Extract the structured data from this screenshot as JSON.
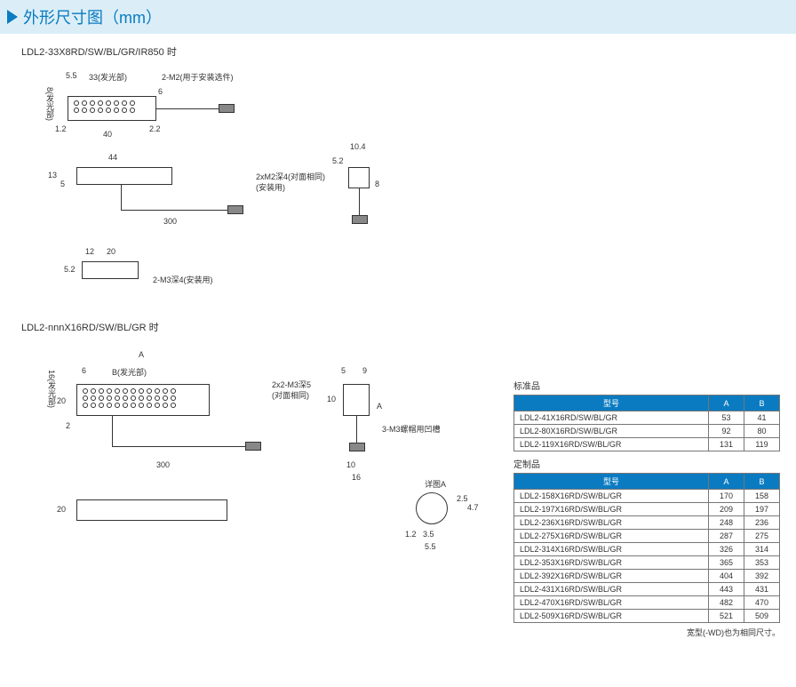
{
  "header": {
    "title": "外形尺寸图（mm）"
  },
  "section1": {
    "label": "LDL2-33X8RD/SW/BL/GR/IR850 时"
  },
  "drawing1": {
    "d5_5": "5.5",
    "d33": "33(发光部)",
    "d2m2": "2-M2(用于安装选件)",
    "d8": "8(发光部)",
    "d1_2": "1.2",
    "d6": "6",
    "d40": "40",
    "d2_2": "2.2",
    "d44": "44",
    "d13": "13",
    "d5a": "5",
    "d2xm2": "2xM2深4(对面相同)",
    "d_install": "(安装用)",
    "d300": "300",
    "d10_4": "10.4",
    "d5_2b": "5.2",
    "d8b": "8",
    "d12": "12",
    "d20": "20",
    "d5_2": "5.2",
    "d2m3": "2-M3深4(安装用)"
  },
  "section2": {
    "label": "LDL2-nnnX16RD/SW/BL/GR 时"
  },
  "drawing2": {
    "dA": "A",
    "d6": "6",
    "dB": "B(发光部)",
    "d16": "16(发光部)",
    "d20": "20",
    "d2": "2",
    "d2x2m3": "2x2-M3深5",
    "d_facing": "(对面相同)",
    "d5": "5",
    "d9": "9",
    "d10": "10",
    "dAside": "A",
    "d3m3": "3-M3螺帽用凹槽",
    "d300": "300",
    "d10b": "10",
    "d16b": "16",
    "d20b": "20",
    "detailA": "详图A",
    "d2_5": "2.5",
    "d4_7": "4.7",
    "d1_2": "1.2",
    "d3_5": "3.5",
    "d5_5": "5.5"
  },
  "tables": {
    "std_title": "标准品",
    "custom_title": "定制品",
    "col_model": "型号",
    "col_a": "A",
    "col_b": "B",
    "std_rows": [
      {
        "m": "LDL2-41X16RD/SW/BL/GR",
        "a": "53",
        "b": "41"
      },
      {
        "m": "LDL2-80X16RD/SW/BL/GR",
        "a": "92",
        "b": "80"
      },
      {
        "m": "LDL2-119X16RD/SW/BL/GR",
        "a": "131",
        "b": "119"
      }
    ],
    "custom_rows": [
      {
        "m": "LDL2-158X16RD/SW/BL/GR",
        "a": "170",
        "b": "158"
      },
      {
        "m": "LDL2-197X16RD/SW/BL/GR",
        "a": "209",
        "b": "197"
      },
      {
        "m": "LDL2-236X16RD/SW/BL/GR",
        "a": "248",
        "b": "236"
      },
      {
        "m": "LDL2-275X16RD/SW/BL/GR",
        "a": "287",
        "b": "275"
      },
      {
        "m": "LDL2-314X16RD/SW/BL/GR",
        "a": "326",
        "b": "314"
      },
      {
        "m": "LDL2-353X16RD/SW/BL/GR",
        "a": "365",
        "b": "353"
      },
      {
        "m": "LDL2-392X16RD/SW/BL/GR",
        "a": "404",
        "b": "392"
      },
      {
        "m": "LDL2-431X16RD/SW/BL/GR",
        "a": "443",
        "b": "431"
      },
      {
        "m": "LDL2-470X16RD/SW/BL/GR",
        "a": "482",
        "b": "470"
      },
      {
        "m": "LDL2-509X16RD/SW/BL/GR",
        "a": "521",
        "b": "509"
      }
    ],
    "footnote": "宽型(-WD)也为相同尺寸。"
  }
}
